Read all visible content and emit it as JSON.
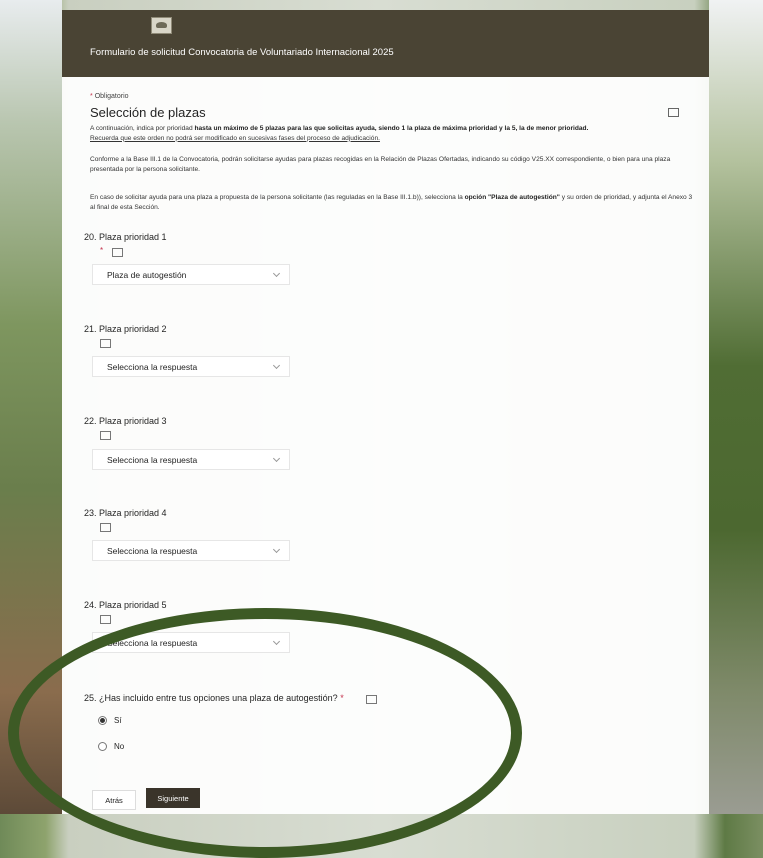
{
  "header": {
    "title": "Formulario de solicitud Convocatoria de Voluntariado Internacional 2025"
  },
  "form": {
    "required_star": "*",
    "required_label": "Obligatorio",
    "section_title": "Selección de plazas",
    "p1_a": "A continuación, indica por prioridad ",
    "p1_b": "hasta un máximo de 5 plazas para las que solicitas ayuda, siendo 1 la plaza de máxima prioridad y la 5, la de menor prioridad.",
    "p1_c": "Recuerda que este orden no podrá ser modificado en sucesivas fases del proceso de adjudicación.",
    "p2": "Conforme a la Base III.1 de la Convocatoria, podrán solicitarse ayudas para plazas recogidas en la Relación de Plazas Ofertadas, indicando su código V25.XX correspondiente, o bien para una plaza presentada por la persona solicitante.",
    "p3_a": "En caso de solicitar ayuda para una plaza a propuesta de la persona solicitante (las reguladas en la Base III.1.b)), selecciona la ",
    "p3_b": "opción \"Plaza de autogestión\"",
    "p3_c": " y su orden de prioridad, y adjunta el Anexo 3 al final de esta Sección.",
    "questions": [
      {
        "title": "20. Plaza prioridad 1",
        "required": "*",
        "value": "Plaza de autogestión"
      },
      {
        "title": "21. Plaza prioridad 2",
        "value": "Selecciona la respuesta"
      },
      {
        "title": "22. Plaza prioridad 3",
        "value": "Selecciona la respuesta"
      },
      {
        "title": "23. Plaza prioridad 4",
        "value": "Selecciona la respuesta"
      },
      {
        "title": "24. Plaza prioridad 5",
        "value": "Selecciona la respuesta"
      }
    ],
    "q25": {
      "title": "25. ¿Has incluido entre tus opciones una plaza de autogestión?",
      "required": "*",
      "options": [
        "Sí",
        "No"
      ],
      "selected": "Sí"
    },
    "back_label": "Atrás",
    "next_label": "Siguiente"
  },
  "colors": {
    "header_bg": "#4a4434",
    "required_red": "#c4314b",
    "annotation_ellipse": "#3d5a25"
  }
}
